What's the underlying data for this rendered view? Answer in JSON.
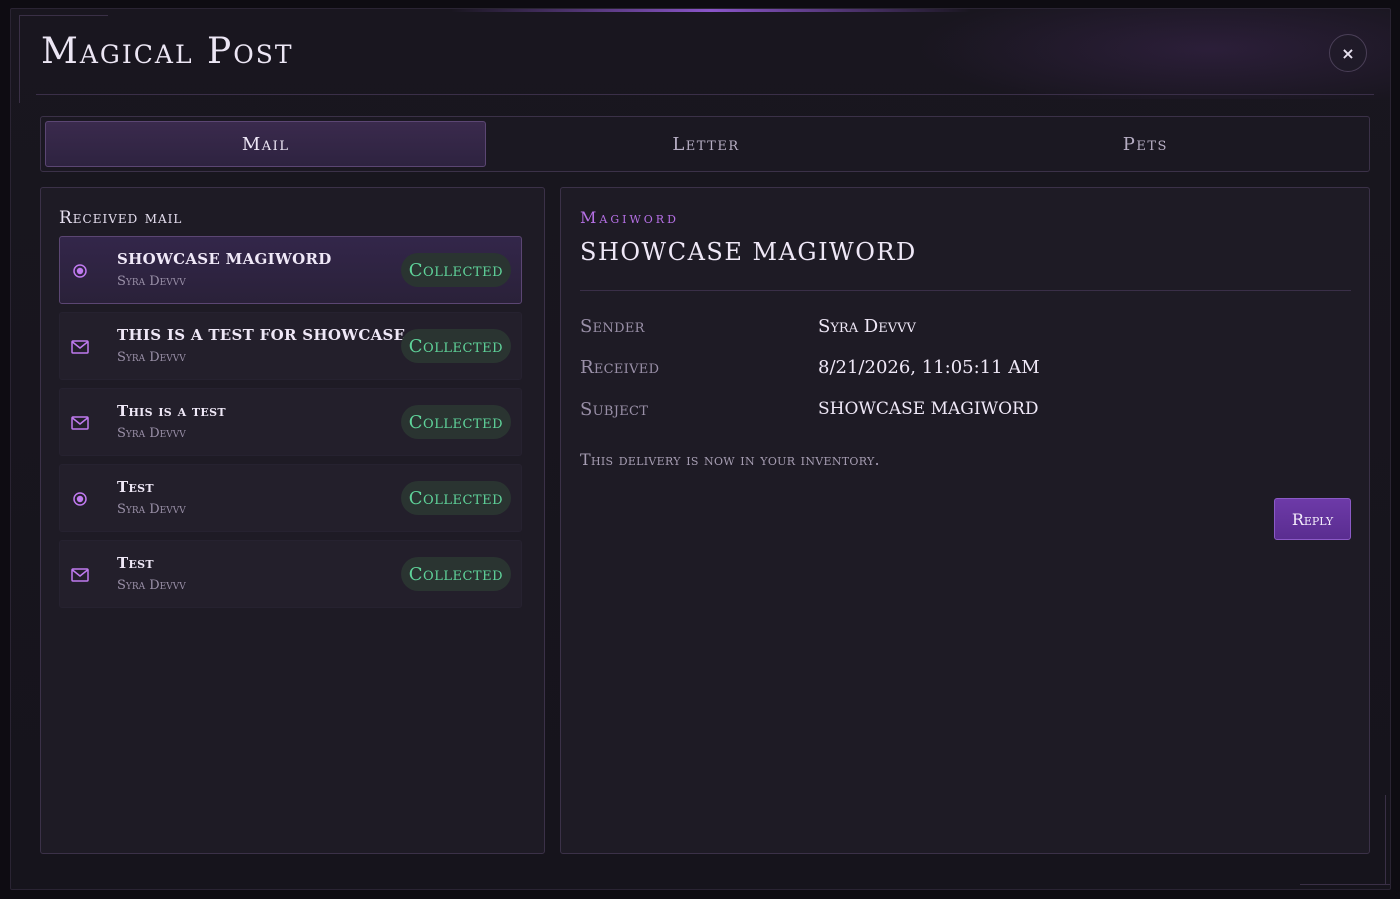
{
  "window": {
    "title": "Magical Post",
    "close_glyph": "×"
  },
  "tabs": [
    {
      "label": "Mail",
      "active": true
    },
    {
      "label": "Letter",
      "active": false
    },
    {
      "label": "Pets",
      "active": false
    }
  ],
  "mailbox": {
    "title": "Received mail",
    "items": [
      {
        "subject": "SHOWCASE MAGIWORD",
        "sender": "Syra Devvv",
        "status": "Collected",
        "icon": "radio-dot-icon",
        "selected": true
      },
      {
        "subject": "THIS IS A TEST FOR SHOWCASE",
        "sender": "Syra Devvv",
        "status": "Collected",
        "icon": "envelope-icon",
        "selected": false
      },
      {
        "subject": "This is a test",
        "sender": "Syra Devvv",
        "status": "Collected",
        "icon": "envelope-icon",
        "selected": false
      },
      {
        "subject": "Test",
        "sender": "Syra Devvv",
        "status": "Collected",
        "icon": "radio-dot-icon",
        "selected": false
      },
      {
        "subject": "Test",
        "sender": "Syra Devvv",
        "status": "Collected",
        "icon": "envelope-icon",
        "selected": false
      }
    ]
  },
  "detail": {
    "category": "Magiword",
    "title": "SHOWCASE MAGIWORD",
    "sender_label": "Sender",
    "sender_value": "Syra Devvv",
    "received_label": "Received",
    "received_value": "8/21/2026, 11:05:11 AM",
    "subject_label": "Subject",
    "subject_value": "SHOWCASE MAGIWORD",
    "body": "This delivery is now in your inventory.",
    "reply_label": "Reply"
  },
  "colors": {
    "accent": "#b670e6",
    "collected": "#5fd39a",
    "button": "#6d3aa8"
  }
}
